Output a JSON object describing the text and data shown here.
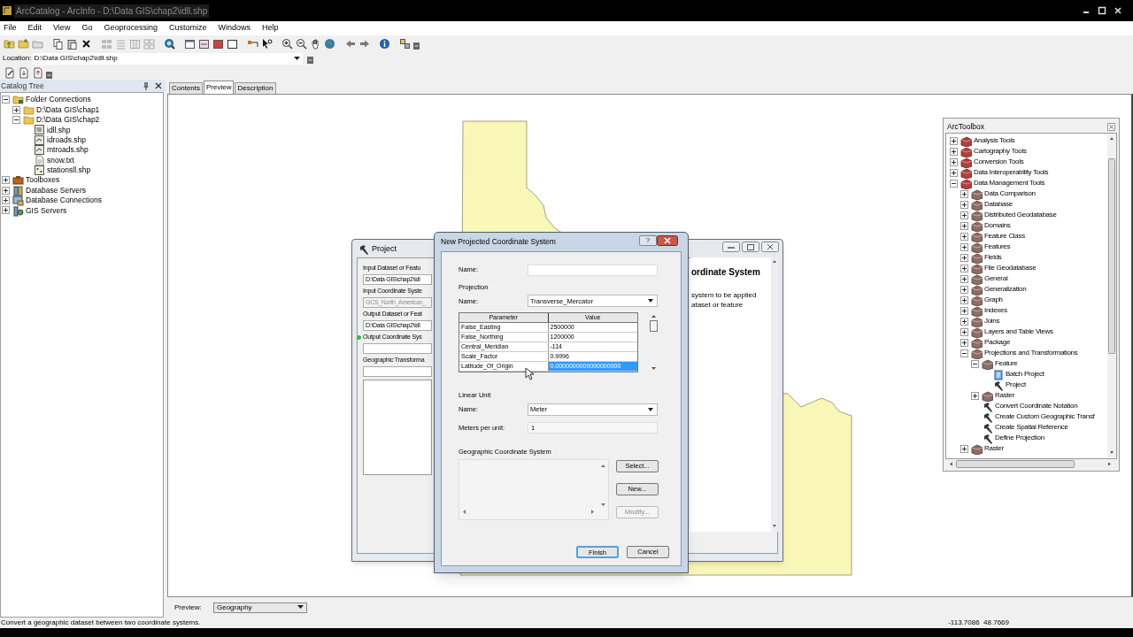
{
  "window": {
    "title": "ArcCatalog - ArcInfo - D:\\Data GIS\\chap2\\idll.shp"
  },
  "menu": [
    "File",
    "Edit",
    "View",
    "Go",
    "Geoprocessing",
    "Customize",
    "Windows",
    "Help"
  ],
  "location": {
    "label": "Location:",
    "value": "D:\\Data GIS\\chap2\\idll.shp"
  },
  "catalog_tree": {
    "title": "Catalog Tree",
    "items": [
      {
        "label": "Folder Connections",
        "kind": "folder-connections",
        "expanded": true,
        "children": [
          {
            "label": "D:\\Data GIS\\chap1",
            "kind": "folder",
            "expanded": false
          },
          {
            "label": "D:\\Data GIS\\chap2",
            "kind": "folder",
            "expanded": true,
            "children": [
              {
                "label": "idll.shp",
                "kind": "polygon-shapefile"
              },
              {
                "label": "idroads.shp",
                "kind": "line-shapefile"
              },
              {
                "label": "mtroads.shp",
                "kind": "line-shapefile"
              },
              {
                "label": "snow.txt",
                "kind": "text-file"
              },
              {
                "label": "stationsll.shp",
                "kind": "point-shapefile"
              }
            ]
          }
        ]
      },
      {
        "label": "Toolboxes",
        "kind": "toolboxes",
        "expanded": false
      },
      {
        "label": "Database Servers",
        "kind": "database-servers",
        "expanded": false
      },
      {
        "label": "Database Connections",
        "kind": "database-connections",
        "expanded": false
      },
      {
        "label": "GIS Servers",
        "kind": "gis-servers",
        "expanded": false
      }
    ]
  },
  "tabs": [
    {
      "label": "Contents",
      "selected": false
    },
    {
      "label": "Preview",
      "selected": true
    },
    {
      "label": "Description",
      "selected": false
    }
  ],
  "project_dialog": {
    "title": "Project",
    "fields": [
      {
        "kind": "label",
        "text": "Input Dataset or Featu"
      },
      {
        "kind": "field",
        "text": "D:\\Data GIS\\chap2\\idl"
      },
      {
        "kind": "label",
        "text": "Input Coordinate Syste"
      },
      {
        "kind": "disabled-field",
        "text": "GCS_North_American_"
      },
      {
        "kind": "label",
        "text": "Output Dataset or Feat"
      },
      {
        "kind": "field",
        "text": "D:\\Data GIS\\chap2\\idl"
      },
      {
        "kind": "required-label",
        "text": "Output Coordinate Sys"
      },
      {
        "kind": "field"
      },
      {
        "kind": "label",
        "text": "Geographic Transforma"
      },
      {
        "kind": "field"
      },
      {
        "kind": "list"
      }
    ],
    "help": {
      "heading": "ordinate System",
      "lines": [
        "system to be applied",
        "ataset or feature"
      ]
    }
  },
  "projected_dialog": {
    "title": "New Projected Coordinate System",
    "help_button": "?",
    "name_label": "Name:",
    "projection": {
      "title": "Projection",
      "name_label": "Name:",
      "value": "Transverse_Mercator"
    },
    "parameters": {
      "columns": [
        "Parameter",
        "Value"
      ],
      "rows": [
        {
          "parameter": "False_Easting",
          "value": "2500000",
          "selected": false
        },
        {
          "parameter": "False_Northing",
          "value": "1200000",
          "selected": false
        },
        {
          "parameter": "Central_Meridian",
          "value": "-114",
          "selected": false
        },
        {
          "parameter": "Scale_Factor",
          "value": "0.9996",
          "selected": false
        },
        {
          "parameter": "Latitude_Of_Origin",
          "value": "0.0000000000000000000",
          "selected": true
        }
      ]
    },
    "linear_unit": {
      "title": "Linear Unit",
      "name_label": "Name:",
      "value": "Meter",
      "meters_label": "Meters per unit:",
      "meters_value": "1"
    },
    "geographic": {
      "title": "Geographic Coordinate System",
      "buttons": [
        {
          "label": "Select...",
          "disabled": false
        },
        {
          "label": "New...",
          "disabled": false
        },
        {
          "label": "Modify...",
          "disabled": true
        }
      ]
    },
    "buttons": [
      {
        "label": "Finish",
        "default": true
      },
      {
        "label": "Cancel",
        "default": false
      }
    ]
  },
  "toolbox": {
    "title": "ArcToolbox",
    "items": [
      {
        "label": "Analysis Tools",
        "kind": "toolbox",
        "expanded": false
      },
      {
        "label": "Cartography Tools",
        "kind": "toolbox",
        "expanded": false
      },
      {
        "label": "Conversion Tools",
        "kind": "toolbox",
        "expanded": false
      },
      {
        "label": "Data Interoperability Tools",
        "kind": "toolbox",
        "expanded": false
      },
      {
        "label": "Data Management Tools",
        "kind": "toolbox",
        "expanded": true,
        "children": [
          {
            "label": "Data Comparison",
            "kind": "toolset",
            "expanded": false
          },
          {
            "label": "Database",
            "kind": "toolset",
            "expanded": false
          },
          {
            "label": "Distributed Geodatabase",
            "kind": "toolset",
            "expanded": false
          },
          {
            "label": "Domains",
            "kind": "toolset",
            "expanded": false
          },
          {
            "label": "Feature Class",
            "kind": "toolset",
            "expanded": false
          },
          {
            "label": "Features",
            "kind": "toolset",
            "expanded": false
          },
          {
            "label": "Fields",
            "kind": "toolset",
            "expanded": false
          },
          {
            "label": "File Geodatabase",
            "kind": "toolset",
            "expanded": false
          },
          {
            "label": "General",
            "kind": "toolset",
            "expanded": false
          },
          {
            "label": "Generalization",
            "kind": "toolset",
            "expanded": false
          },
          {
            "label": "Graph",
            "kind": "toolset",
            "expanded": false
          },
          {
            "label": "Indexes",
            "kind": "toolset",
            "expanded": false
          },
          {
            "label": "Joins",
            "kind": "toolset",
            "expanded": false
          },
          {
            "label": "Layers and Table Views",
            "kind": "toolset",
            "expanded": false
          },
          {
            "label": "Package",
            "kind": "toolset",
            "expanded": false
          },
          {
            "label": "Projections and Transformations",
            "kind": "toolset",
            "expanded": true,
            "children": [
              {
                "label": "Feature",
                "kind": "toolset",
                "expanded": true,
                "children": [
                  {
                    "label": "Batch Project",
                    "kind": "batch-tool"
                  },
                  {
                    "label": "Project",
                    "kind": "tool"
                  }
                ]
              },
              {
                "label": "Raster",
                "kind": "toolset",
                "expanded": false
              },
              {
                "label": "Convert Coordinate Notation",
                "kind": "tool"
              },
              {
                "label": "Create Custom Geographic Transf",
                "kind": "tool"
              },
              {
                "label": "Create Spatial Reference",
                "kind": "tool"
              },
              {
                "label": "Define Projection",
                "kind": "tool"
              }
            ]
          },
          {
            "label": "Raster",
            "kind": "toolset",
            "expanded": false
          }
        ]
      }
    ]
  },
  "preview_bar": {
    "label": "Preview:",
    "value": "Geography"
  },
  "status_bar": {
    "message": "Convert a geographic dataset between two coordinate systems.",
    "coordinates": "-113.7086  48.7669"
  }
}
